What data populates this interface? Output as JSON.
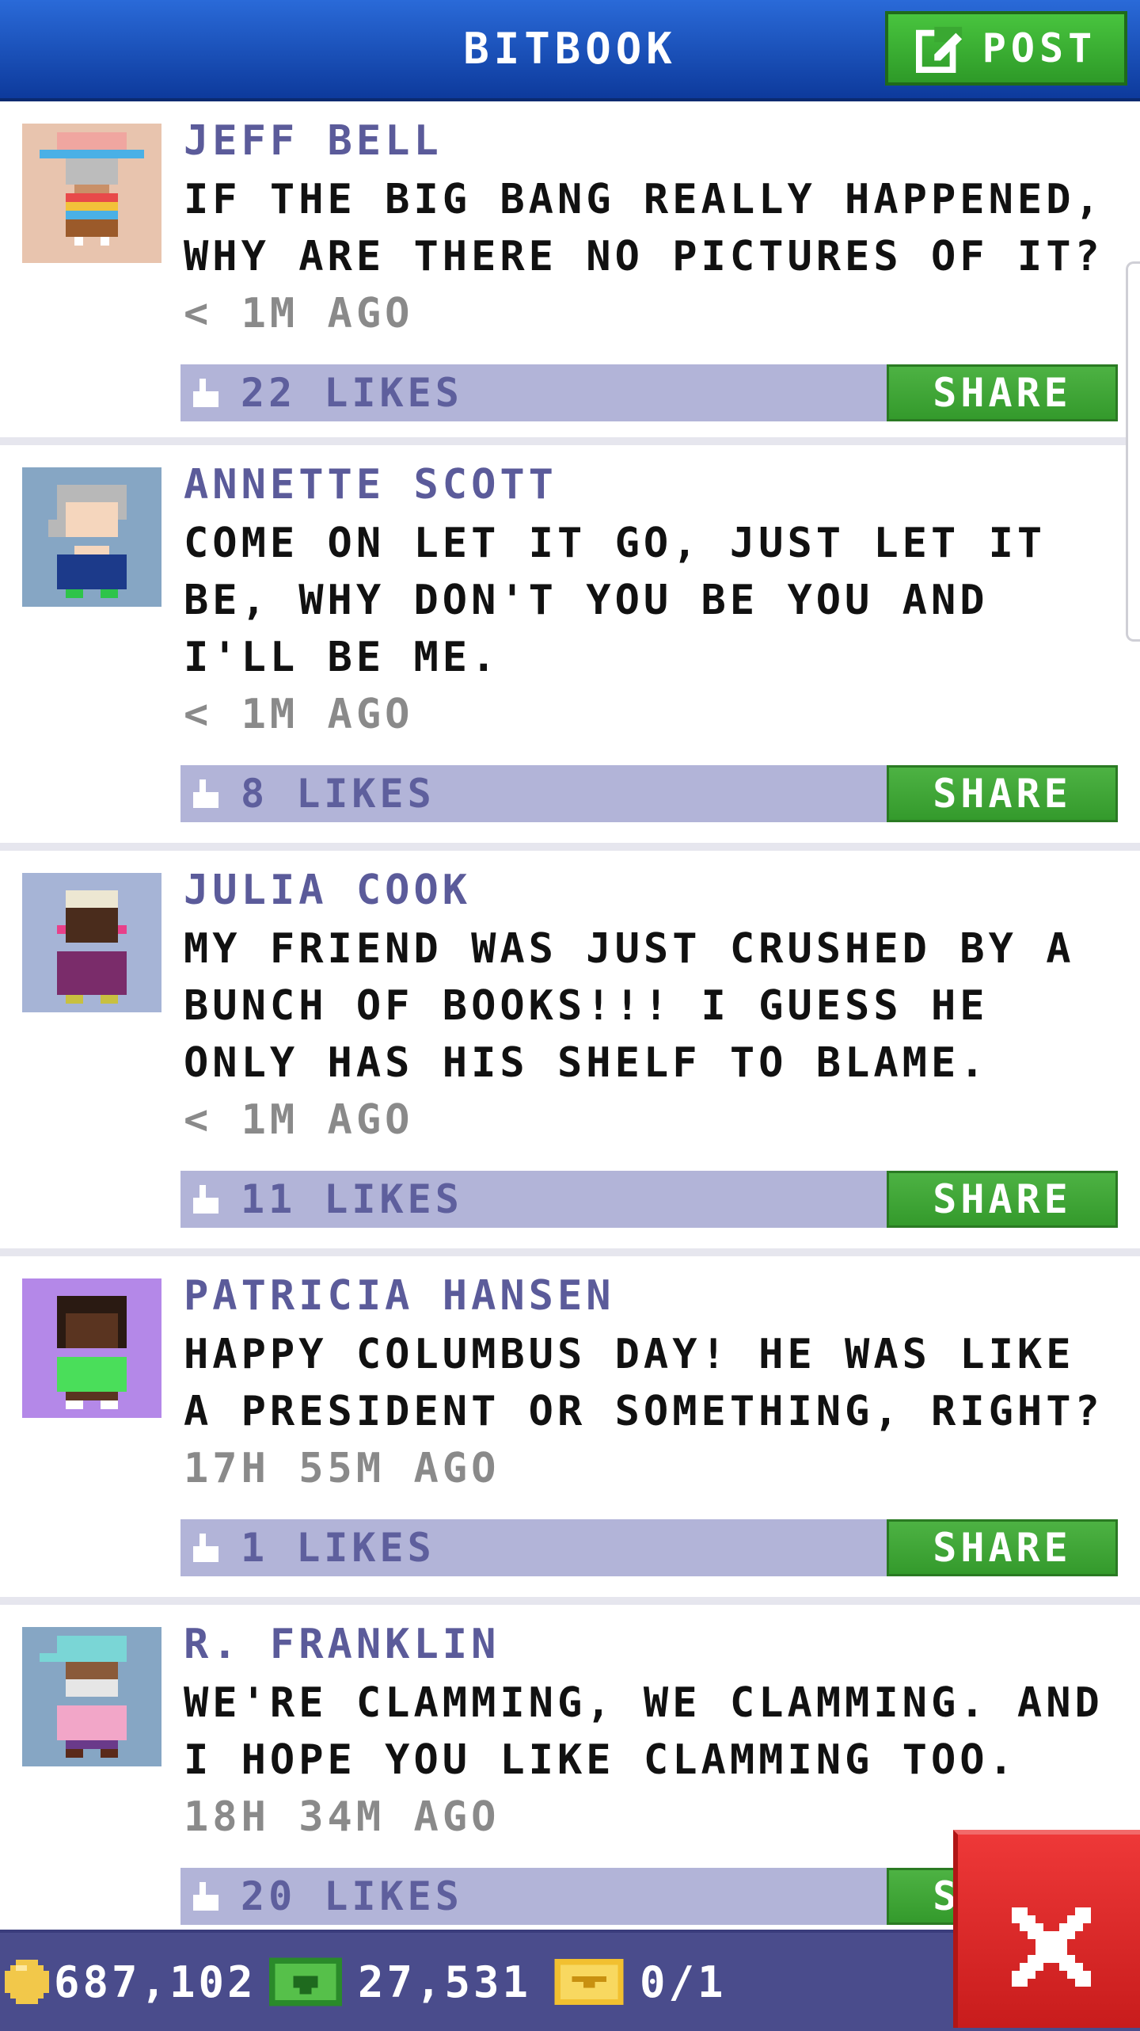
{
  "header": {
    "title": "BITBOOK",
    "post_label": "POST"
  },
  "posts": [
    {
      "author": "JEFF BELL",
      "text": "IF THE BIG BANG REALLY HAPPENED, WHY ARE THERE NO PICTURES OF IT?",
      "time": "< 1M AGO",
      "likes": "22 LIKES",
      "share_label": "SHARE",
      "avatar_bg": "#e8c4ae"
    },
    {
      "author": "ANNETTE SCOTT",
      "text": "COME ON LET IT GO, JUST LET IT BE, WHY DON'T YOU BE YOU AND I'LL BE ME.",
      "time": "< 1M AGO",
      "likes": "8 LIKES",
      "share_label": "SHARE",
      "avatar_bg": "#86a6c4"
    },
    {
      "author": "JULIA COOK",
      "text": "MY FRIEND WAS JUST CRUSHED BY A BUNCH OF BOOKS!!! I GUESS HE ONLY HAS HIS SHELF TO BLAME.",
      "time": "< 1M AGO",
      "likes": "11 LIKES",
      "share_label": "SHARE",
      "avatar_bg": "#a6b4d6"
    },
    {
      "author": "PATRICIA HANSEN",
      "text": "HAPPY COLUMBUS DAY! HE WAS LIKE A PRESIDENT OR SOMETHING, RIGHT?",
      "time": "17H 55M AGO",
      "likes": "1 LIKES",
      "share_label": "SHARE",
      "avatar_bg": "#b488e8"
    },
    {
      "author": "R. FRANKLIN",
      "text": "WE'RE CLAMMING, WE CLAMMING. AND I HOPE YOU LIKE CLAMMING TOO.",
      "time": "18H 34M AGO",
      "likes": "20 LIKES",
      "share_label": "SHARE",
      "avatar_bg": "#86a6c4"
    }
  ],
  "footer": {
    "coins": "687,102",
    "bux": "27,531",
    "tickets": "0/1"
  },
  "icons": {
    "post": "edit-icon",
    "like": "thumbs-up-icon",
    "coin": "coin-icon",
    "bux": "bux-icon",
    "ticket": "ticket-icon",
    "close": "close-icon"
  },
  "colors": {
    "header": "#1a4fbf",
    "accent_green": "#3aa832",
    "likes_bar": "#b2b4d8",
    "author": "#5b5b9a",
    "footer": "#4a4c8c",
    "close": "#e02a2a"
  }
}
